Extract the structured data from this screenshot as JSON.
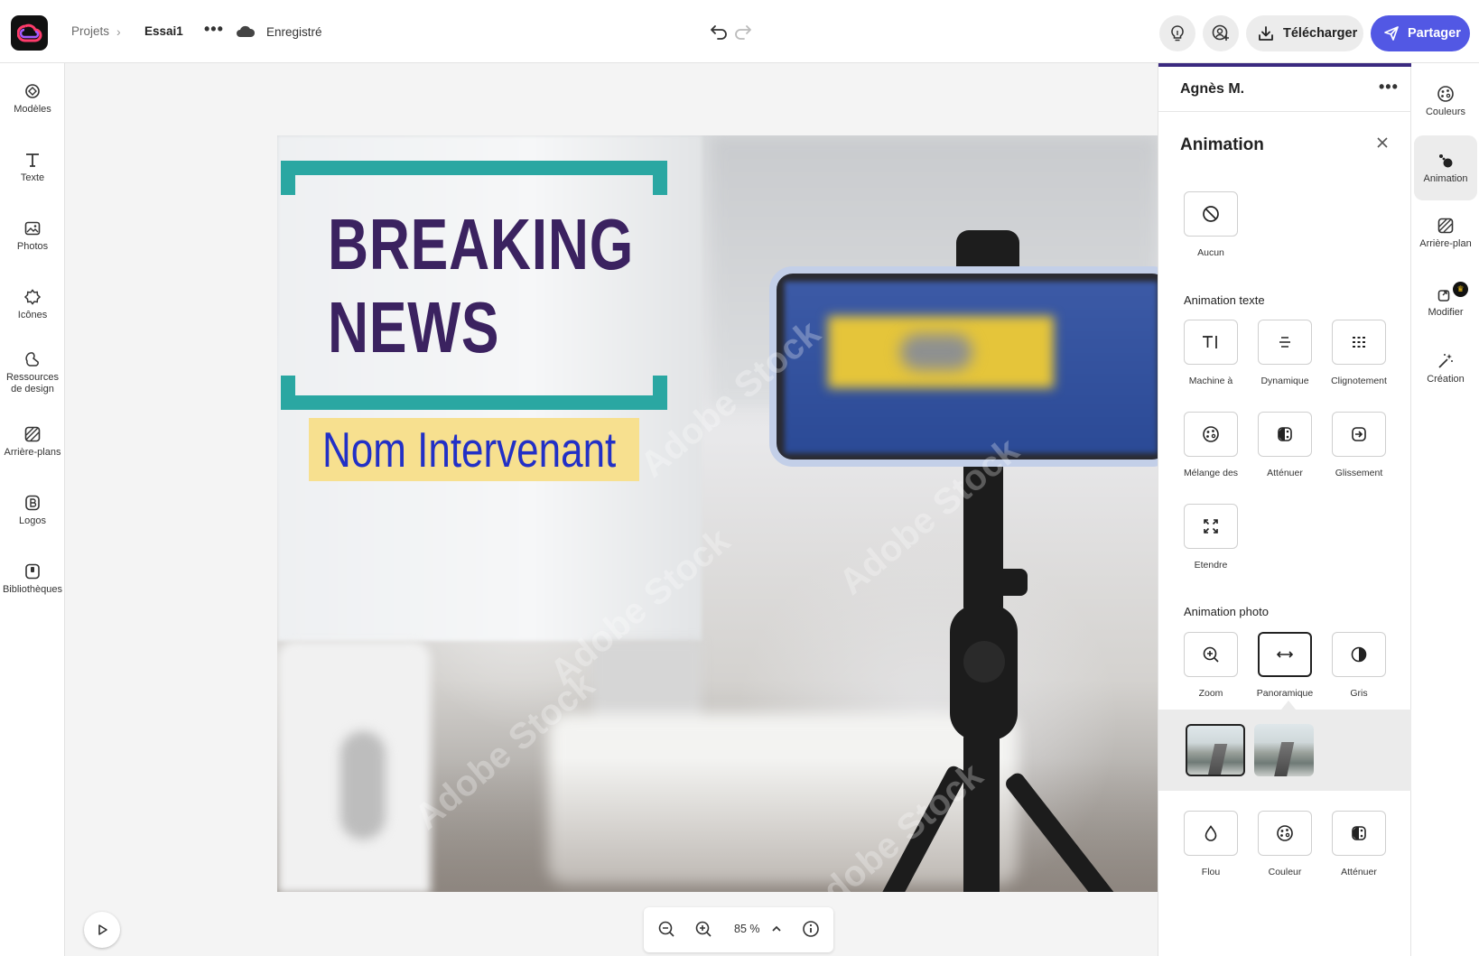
{
  "header": {
    "breadcrumb_root": "Projets",
    "project_name": "Essai1",
    "more_menu": "•••",
    "save_status": "Enregistré",
    "download_label": "Télécharger",
    "share_label": "Partager",
    "colors": {
      "share_bg": "#5258e4"
    }
  },
  "left_rail": {
    "items": [
      {
        "label": "Modèles",
        "icon": "templates-icon"
      },
      {
        "label": "Texte",
        "icon": "text-icon"
      },
      {
        "label": "Photos",
        "icon": "photos-icon"
      },
      {
        "label": "Icônes",
        "icon": "icons-icon"
      },
      {
        "label": "Ressources de design",
        "icon": "design-assets-icon"
      },
      {
        "label": "Arrière-plans",
        "icon": "backgrounds-icon"
      },
      {
        "label": "Logos",
        "icon": "logos-icon"
      },
      {
        "label": "Bibliothèques",
        "icon": "libraries-icon"
      }
    ]
  },
  "canvas": {
    "headline_line1": "BREAKING",
    "headline_line2": "NEWS",
    "speaker": "Nom Intervenant",
    "watermark": "Adobe Stock",
    "colors": {
      "frame": "#2aa7a2",
      "headline": "#3b2260",
      "speaker_bg": "#f7e08f",
      "speaker_text": "#2230c6"
    }
  },
  "zoom": {
    "value": "85 %"
  },
  "panel": {
    "user_name": "Agnès M.",
    "more_menu": "•••",
    "title": "Animation",
    "none_label": "Aucun",
    "text_section": "Animation texte",
    "text_animations": [
      {
        "label": "Machine à",
        "icon": "typewriter-icon"
      },
      {
        "label": "Dynamique",
        "icon": "dynamic-icon"
      },
      {
        "label": "Clignotement",
        "icon": "blink-icon"
      },
      {
        "label": "Mélange des",
        "icon": "mix-icon"
      },
      {
        "label": "Atténuer",
        "icon": "fade-icon"
      },
      {
        "label": "Glissement",
        "icon": "slide-icon"
      },
      {
        "label": "Etendre",
        "icon": "expand-icon"
      }
    ],
    "photo_section": "Animation photo",
    "photo_animations": [
      {
        "label": "Zoom",
        "icon": "zoom-icon"
      },
      {
        "label": "Panoramique",
        "icon": "pan-icon",
        "selected": true
      },
      {
        "label": "Gris",
        "icon": "grayscale-icon"
      }
    ],
    "photo_animations_2": [
      {
        "label": "Flou",
        "icon": "blur-icon"
      },
      {
        "label": "Couleur",
        "icon": "color-icon"
      },
      {
        "label": "Atténuer",
        "icon": "fade-icon"
      }
    ]
  },
  "right_rail": {
    "items": [
      {
        "label": "Couleurs",
        "icon": "palette-icon"
      },
      {
        "label": "Animation",
        "icon": "animation-icon",
        "active": true
      },
      {
        "label": "Arrière-plan",
        "icon": "background-icon"
      },
      {
        "label": "Modifier",
        "icon": "edit-icon",
        "premium": true
      },
      {
        "label": "Création",
        "icon": "magic-wand-icon"
      }
    ]
  }
}
